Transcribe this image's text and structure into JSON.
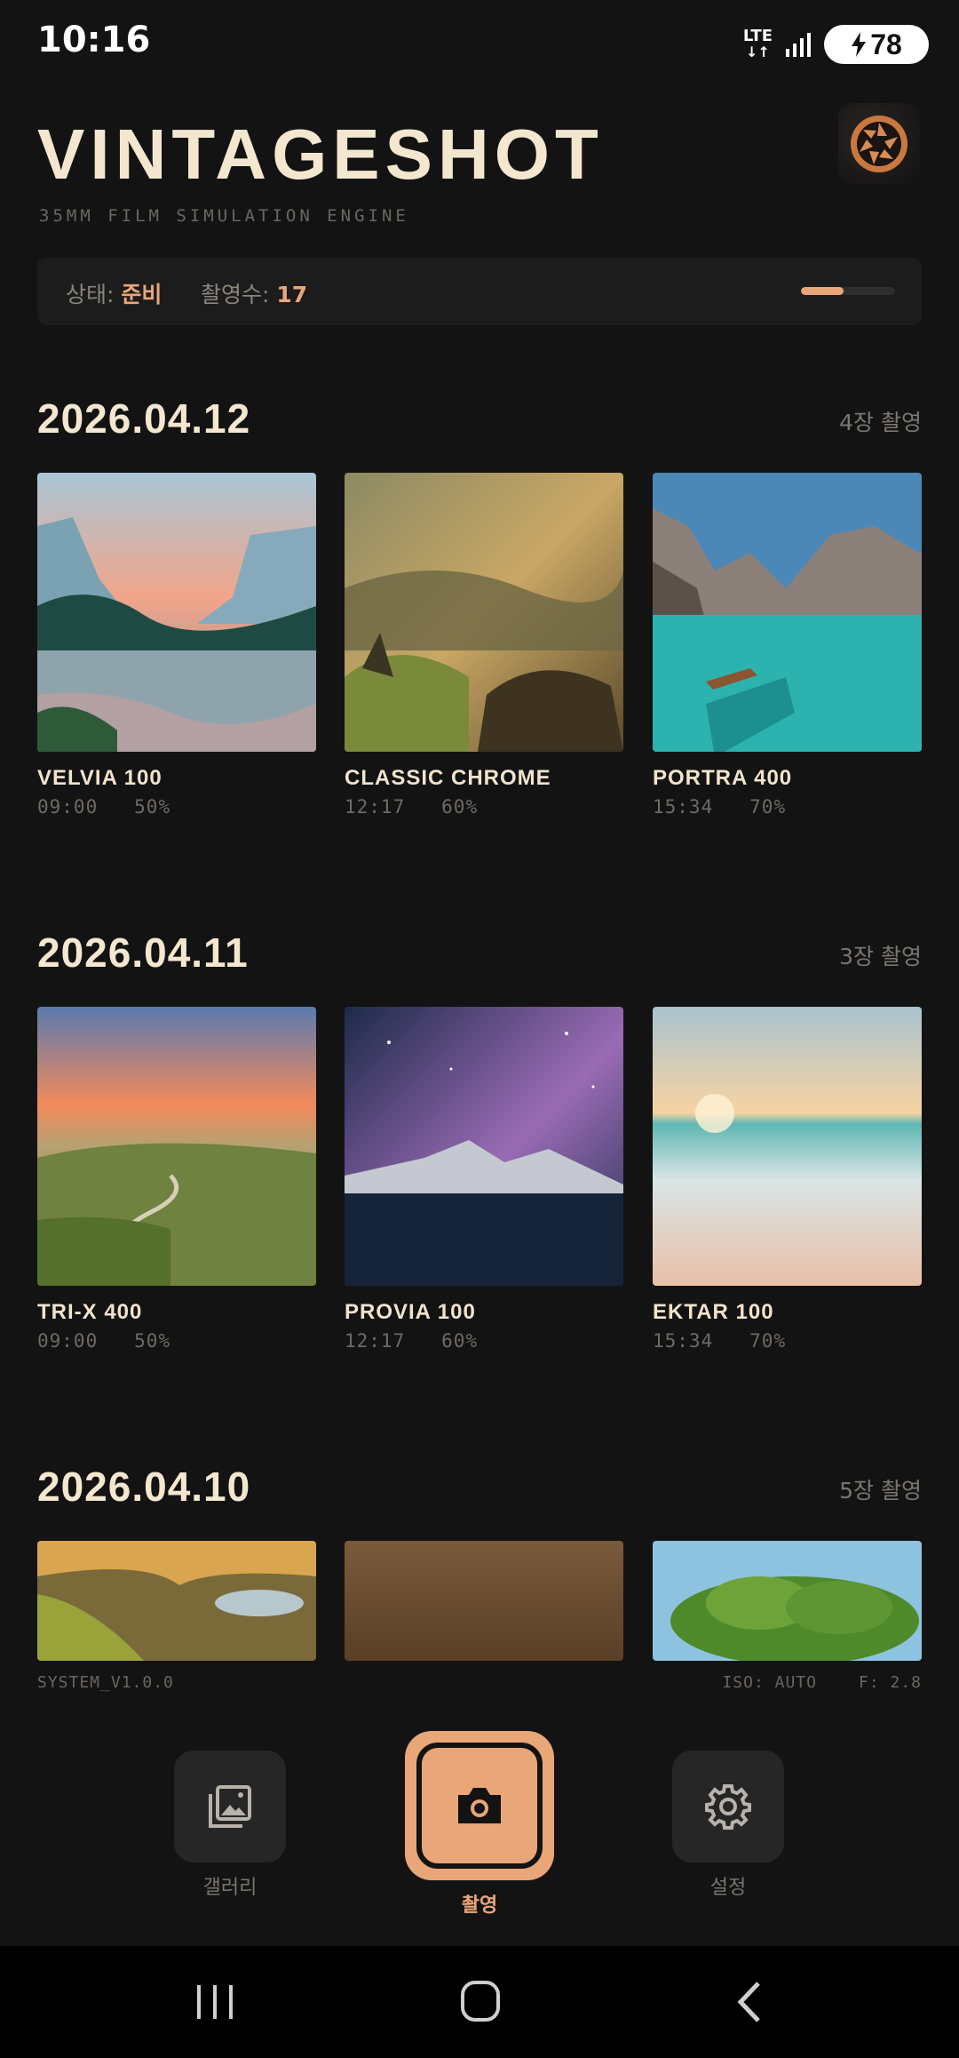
{
  "status_bar": {
    "time": "10:16",
    "network": "LTE",
    "battery": "78"
  },
  "header": {
    "title": "VINTAGESHOT",
    "subtitle": "35MM FILM SIMULATION ENGINE",
    "logo_icon": "aperture-icon"
  },
  "status": {
    "state_label": "상태:",
    "state_value": "준비",
    "shots_label": "촬영수:",
    "shots_value": "17",
    "progress": 0.45
  },
  "sections": [
    {
      "date": "2026.04.12",
      "count": "4장 촬영",
      "photos": [
        {
          "title": "VELVIA 100",
          "time": "09:00",
          "percent": "50%"
        },
        {
          "title": "CLASSIC CHROME",
          "time": "12:17",
          "percent": "60%"
        },
        {
          "title": "PORTRA 400",
          "time": "15:34",
          "percent": "70%"
        }
      ]
    },
    {
      "date": "2026.04.11",
      "count": "3장 촬영",
      "photos": [
        {
          "title": "TRI-X 400",
          "time": "09:00",
          "percent": "50%"
        },
        {
          "title": "PROVIA 100",
          "time": "12:17",
          "percent": "60%"
        },
        {
          "title": "EKTAR 100",
          "time": "15:34",
          "percent": "70%"
        }
      ]
    },
    {
      "date": "2026.04.10",
      "count": "5장 촬영"
    }
  ],
  "footer": {
    "version": "SYSTEM_V1.0.0",
    "iso": "ISO: AUTO",
    "fstop": "F: 2.8"
  },
  "nav": {
    "gallery_label": "갤러리",
    "shoot_label": "촬영",
    "settings_label": "설정"
  },
  "colors": {
    "accent": "#e9a679",
    "background": "#131313",
    "text": "#f4e7cf"
  }
}
